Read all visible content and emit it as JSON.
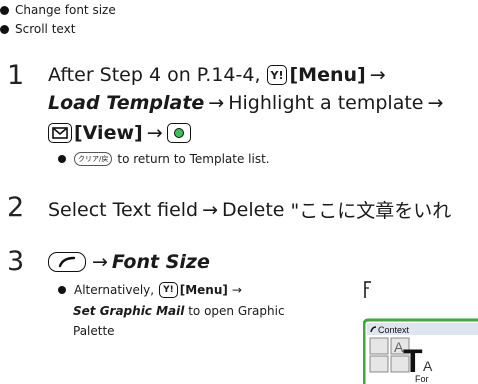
{
  "top_bullets": [
    "Change font size",
    "Scroll text"
  ],
  "step1": {
    "number": "1",
    "line1_prefix": "After Step 4 on P.14-4,",
    "menu_key": "Y!",
    "menu_label": "[Menu]",
    "arrow": "→",
    "load_template": "Load Template",
    "highlight": "Highlight a template",
    "view_label": "[View]",
    "note_key": "クリア/戻",
    "note_text": "to return to Template list."
  },
  "step2": {
    "number": "2",
    "text": "Select Text field",
    "delete_text": "Delete",
    "quote_text": "\"ここに文章をいれ"
  },
  "step3": {
    "number": "3",
    "font_size": "Font Size",
    "alt_prefix": "Alternatively,",
    "menu_label": "[Menu]",
    "set_graphic": "Set Graphic Mail",
    "alt_suffix": "to open Graphic",
    "alt_line3": "Palette"
  },
  "thumbnail": {
    "context_label": "Context",
    "bottom_label": "For"
  },
  "colors": {
    "thumb_border": "#3fa83f",
    "thumb_title_bg": "#dde5ef"
  }
}
